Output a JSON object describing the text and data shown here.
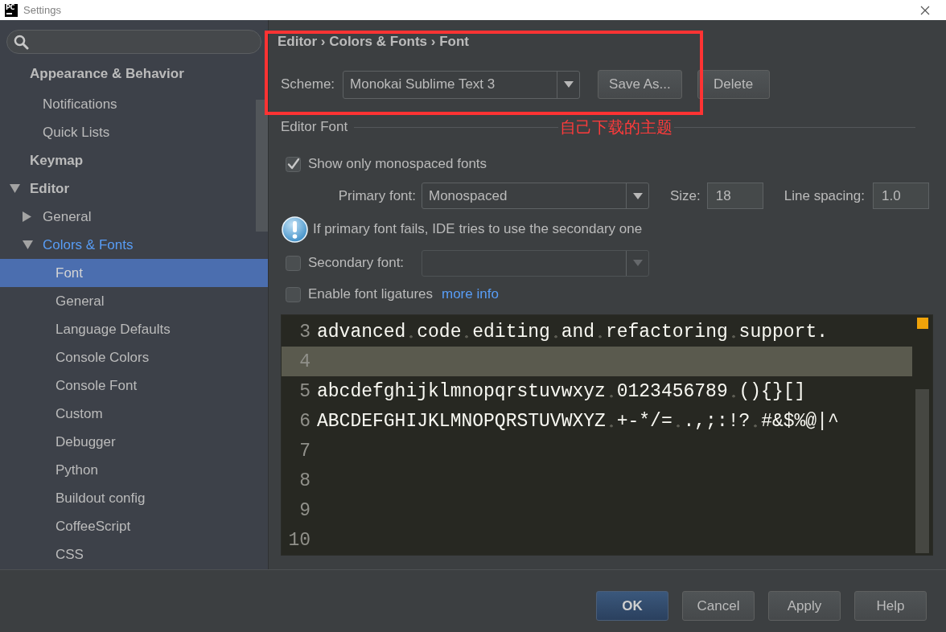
{
  "window": {
    "title": "Settings",
    "app_icon_label": "PC"
  },
  "sidebar": {
    "items": [
      {
        "label": "Appearance & Behavior",
        "selected": false,
        "modified": false,
        "children": [
          {
            "label": "Notifications",
            "selected": false,
            "modified": false
          },
          {
            "label": "Quick Lists",
            "selected": false,
            "modified": false
          }
        ]
      },
      {
        "label": "Keymap",
        "selected": false,
        "modified": false
      },
      {
        "label": "Editor",
        "selected": false,
        "modified": false,
        "expanded": true,
        "children": [
          {
            "label": "General",
            "selected": false,
            "modified": false,
            "expanded": false
          },
          {
            "label": "Colors & Fonts",
            "selected": false,
            "modified": true,
            "expanded": true,
            "children": [
              {
                "label": "Font",
                "selected": true,
                "modified": false
              },
              {
                "label": "General",
                "selected": false,
                "modified": false
              },
              {
                "label": "Language Defaults",
                "selected": false,
                "modified": false
              },
              {
                "label": "Console Colors",
                "selected": false,
                "modified": false
              },
              {
                "label": "Console Font",
                "selected": false,
                "modified": false
              },
              {
                "label": "Custom",
                "selected": false,
                "modified": false
              },
              {
                "label": "Debugger",
                "selected": false,
                "modified": false
              },
              {
                "label": "Python",
                "selected": false,
                "modified": false
              },
              {
                "label": "Buildout config",
                "selected": false,
                "modified": false
              },
              {
                "label": "CoffeeScript",
                "selected": false,
                "modified": false
              },
              {
                "label": "CSS",
                "selected": false,
                "modified": false
              }
            ]
          }
        ]
      }
    ]
  },
  "breadcrumb": "Editor › Colors & Fonts › Font",
  "scheme": {
    "label": "Scheme:",
    "value": "Monokai Sublime Text 3",
    "buttons": [
      "Save As...",
      "Delete"
    ]
  },
  "annotation": {
    "text": "自己下载的主题"
  },
  "editor_font": {
    "title": "Editor Font",
    "monospaced_only": {
      "label": "Show only monospaced fonts",
      "checked": true
    },
    "primary_font": {
      "label": "Primary font:",
      "value": "Monospaced"
    },
    "size": {
      "label": "Size:",
      "value": "18"
    },
    "line_spacing": {
      "label": "Line spacing:",
      "value": "1.0"
    },
    "hint": "If primary font fails, IDE tries to use the secondary one",
    "secondary_font": {
      "label": "Secondary font:",
      "checked": false,
      "disabled": true
    },
    "ligatures": {
      "label": "Enable font ligatures",
      "checked": false,
      "link": "more info"
    }
  },
  "preview": {
    "lines": [
      {
        "number": "3",
        "text": "advanced code editing and refactoring support.",
        "current": false
      },
      {
        "number": "4",
        "current": true
      },
      {
        "number": "5",
        "text": "abcdefghijklmnopqrstuvwxyz 0123456789 (){}[]",
        "current": false
      },
      {
        "number": "6",
        "text": "ABCDEFGHIJKLMNOPQRSTUVWXYZ +-*/= .,;:!? #&$%@|^",
        "current": false
      },
      {
        "number": "7",
        "current": false
      },
      {
        "number": "8",
        "current": false
      },
      {
        "number": "9",
        "current": false
      },
      {
        "number": "10",
        "current": false
      }
    ]
  },
  "buttons": [
    {
      "label": "OK",
      "default": true
    },
    {
      "label": "Cancel",
      "default": false
    },
    {
      "label": "Apply",
      "default": false
    },
    {
      "label": "Help",
      "default": false
    }
  ]
}
